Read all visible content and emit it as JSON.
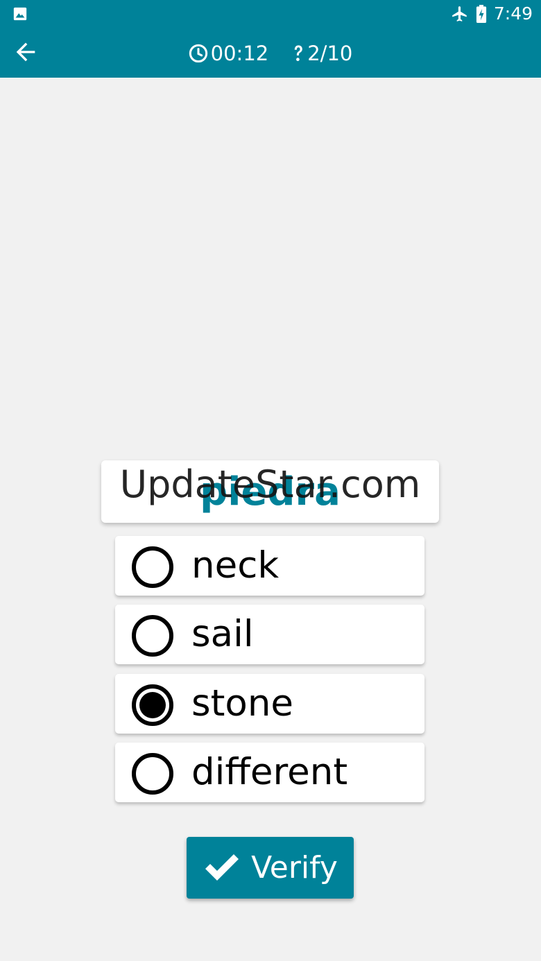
{
  "status_bar": {
    "time": "7:49",
    "icons": [
      "image-icon",
      "airplane-icon",
      "battery-charging-icon"
    ]
  },
  "toolbar": {
    "back_icon": "arrow-back-icon",
    "timer_icon": "clock-icon",
    "timer": "00:12",
    "progress_icon": "question-icon",
    "progress": "2/10"
  },
  "question": {
    "word": "piedra"
  },
  "watermark": {
    "text": "UpdateStar.com"
  },
  "options": [
    {
      "label": "neck",
      "selected": false
    },
    {
      "label": "sail",
      "selected": false
    },
    {
      "label": "stone",
      "selected": true
    },
    {
      "label": "different",
      "selected": false
    }
  ],
  "verify": {
    "label": "Verify",
    "icon": "checkmark-icon"
  },
  "colors": {
    "primary": "#008299",
    "background": "#f1f1f1",
    "card": "#ffffff"
  }
}
